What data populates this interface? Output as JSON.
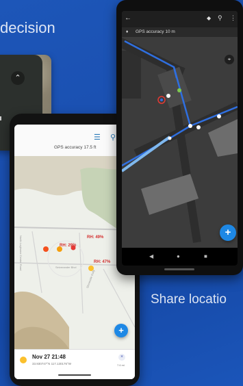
{
  "captions": {
    "top": "decision",
    "bottom": "Share locatio"
  },
  "colors": {
    "background": "#1a4fb0",
    "accent": "#1e88e5",
    "route_blue": "#2f6fe0",
    "poi_red": "#e53935",
    "poi_orange": "#f59e0b",
    "poi_yellow": "#fbc02d"
  },
  "phone_light": {
    "gps_label": "GPS accuracy 17.5 ft",
    "icons": [
      "layers-icon",
      "search-icon"
    ],
    "map_labels": {
      "rh1": "RH: 49%",
      "rh2": "RH: 29%",
      "rh3": "RH: 47%",
      "road1": "North Loghome Center Road",
      "road2": "Seiverander Blvd",
      "road3": "Shoreside Gully"
    },
    "card": {
      "title": "Nov 27 21:48",
      "coords": "33.930747°N  117.130176°W",
      "distance": "7.6 mi",
      "icons": [
        "location-dot-icon",
        "close-icon"
      ]
    },
    "fab_label": "+"
  },
  "phone_dark": {
    "gps_label": "GPS accuracy 10 m",
    "toolbar_icons": [
      "back-icon",
      "layers-icon",
      "search-icon",
      "more-icon"
    ],
    "fab_label": "+",
    "nav": [
      "back-nav-icon",
      "home-nav-icon",
      "recents-nav-icon"
    ]
  }
}
